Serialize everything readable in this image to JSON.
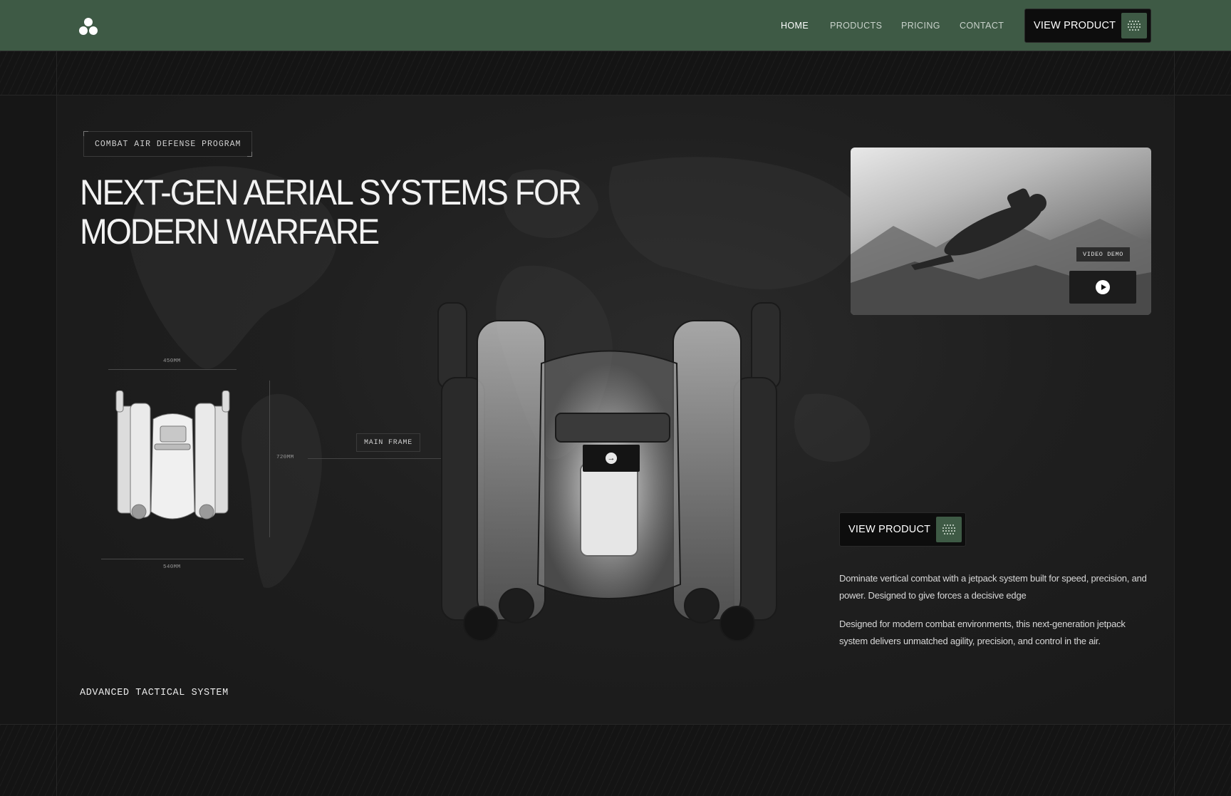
{
  "nav": {
    "links": [
      {
        "label": "HOME",
        "active": true
      },
      {
        "label": "PRODUCTS",
        "active": false
      },
      {
        "label": "PRICING",
        "active": false
      },
      {
        "label": "CONTACT",
        "active": false
      }
    ],
    "cta_label": "VIEW PRODUCT",
    "logo_icon": "tri-circle-logo-icon",
    "cta_icon": "dot-grid-icon"
  },
  "hero": {
    "tag": "COMBAT AIR DEFENSE PROGRAM",
    "headline_line1": "NEXT-GEN AERIAL SYSTEMS FOR",
    "headline_line2": "MODERN WARFARE",
    "dimensions": {
      "width_top": "450MM",
      "height": "720MM",
      "width_bottom": "540MM"
    },
    "callout": "MAIN FRAME",
    "frame_button_icon": "arrow-right-icon",
    "footer_tag": "ADVANCED TACTICAL SYSTEM"
  },
  "video": {
    "label": "VIDEO DEMO",
    "play_icon": "play-icon"
  },
  "side": {
    "cta_label": "VIEW PRODUCT",
    "paragraph1": "Dominate vertical combat with a jetpack system built for speed, precision, and power. Designed to give forces a decisive edge",
    "paragraph2": "Designed for modern combat environments, this next-generation jetpack system delivers unmatched agility, precision, and control in the air."
  },
  "colors": {
    "nav_bg": "#3e5a45",
    "accent": "#3e5a45",
    "page_bg": "#161616"
  }
}
